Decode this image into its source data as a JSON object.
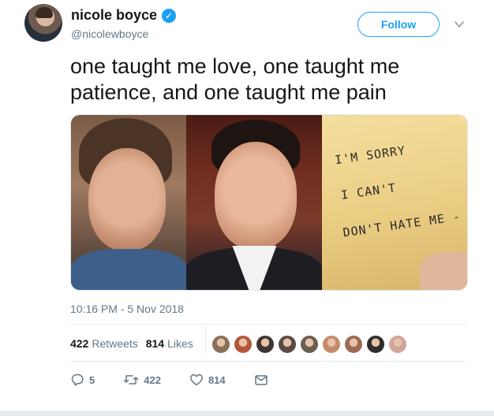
{
  "user": {
    "display_name": "nicole boyce",
    "verified_mark": "✓",
    "handle": "@nicolewboyce",
    "avatar_icon": "profile-photo"
  },
  "follow_button": {
    "label": "Follow"
  },
  "tweet": {
    "text": "one taught me love, one taught me patience, and one taught me pain",
    "media": {
      "note_lines": [
        "I'M SORRY",
        "I CAN'T",
        "DON'T HATE ME -"
      ]
    },
    "timestamp": "10:16 PM - 5 Nov 2018"
  },
  "stats": {
    "retweets_count": "422",
    "retweets_label": "Retweets",
    "likes_count": "814",
    "likes_label": "Likes",
    "liker_colors": [
      "#8a7058",
      "#b4573b",
      "#3c3531",
      "#5a4a46",
      "#6a5e52",
      "#c58a6a",
      "#9a6b55",
      "#2f2d2c",
      "#d2a59a"
    ]
  },
  "actions": {
    "reply_count": "5",
    "retweet_count": "422",
    "like_count": "814"
  },
  "colors": {
    "accent": "#1da1f2",
    "secondary_text": "#657786"
  }
}
